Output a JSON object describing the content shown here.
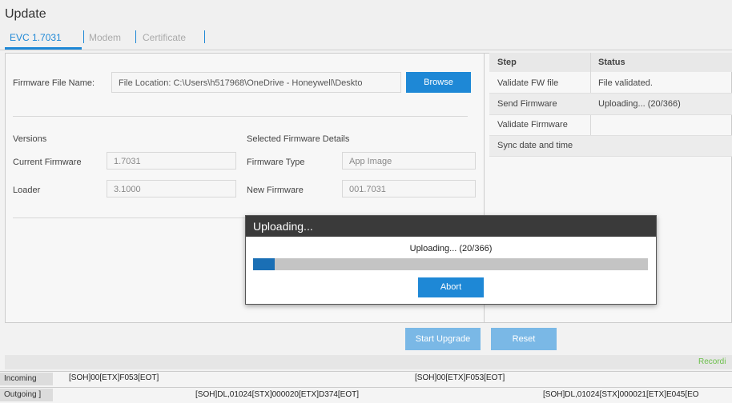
{
  "window": {
    "title": "Update"
  },
  "tabs": [
    {
      "label": "EVC 1.7031",
      "active": true
    },
    {
      "label": "Modem",
      "active": false
    },
    {
      "label": "Certificate",
      "active": false
    }
  ],
  "firmware_file": {
    "label": "Firmware File Name:",
    "value": "File Location:  C:\\Users\\h517968\\OneDrive - Honeywell\\Deskto",
    "browse_label": "Browse"
  },
  "versions": {
    "heading": "Versions",
    "current_label": "Current Firmware",
    "current_value": "1.7031",
    "loader_label": "Loader",
    "loader_value": "3.1000"
  },
  "selected": {
    "heading": "Selected Firmware Details",
    "type_label": "Firmware Type",
    "type_value": "App Image",
    "new_label": "New Firmware",
    "new_value": "001.7031"
  },
  "steps": {
    "headers": [
      "Step",
      "Status"
    ],
    "rows": [
      {
        "step": "Validate FW file",
        "status": "File validated."
      },
      {
        "step": "Send Firmware",
        "status": "Uploading... (20/366)"
      },
      {
        "step": "Validate Firmware",
        "status": ""
      },
      {
        "step": "Sync date and time",
        "status": ""
      }
    ]
  },
  "dialog": {
    "title": "Uploading...",
    "message": "Uploading... (20/366)",
    "progress": 0.055,
    "abort_label": "Abort"
  },
  "actions": {
    "start_label": "Start Upgrade",
    "reset_label": "Reset"
  },
  "status_bar": {
    "recording": "Recordi"
  },
  "log": {
    "incoming_label": "Incoming",
    "incoming_1": "[SOH]00[ETX]F053[EOT]",
    "incoming_2": "[SOH]00[ETX]F053[EOT]",
    "outgoing_label": "Outgoing  ]",
    "outgoing_1": "[SOH]DL,01024[STX]000020[ETX]D374[EOT]",
    "outgoing_2": "[SOH]DL,01024[STX]000021[ETX]E045[EO"
  },
  "colors": {
    "accent": "#1e88d6",
    "progress": "#1a6fb5",
    "dialog_header": "#3a3a3a"
  }
}
